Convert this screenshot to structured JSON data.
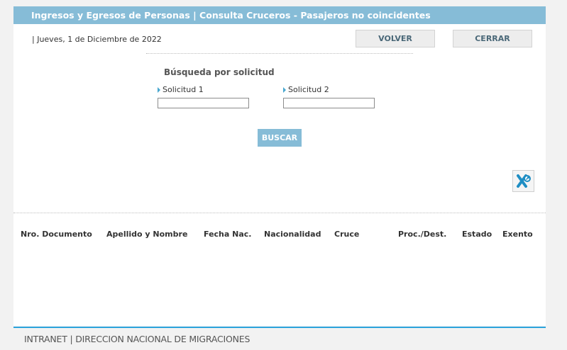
{
  "header": {
    "title": "Ingresos y Egresos de Personas | Consulta Cruceros - Pasajeros no coincidentes"
  },
  "date": "| Jueves, 1 de Diciembre de 2022",
  "buttons": {
    "volver": "VOLVER",
    "cerrar": "CERRAR",
    "buscar": "BUSCAR"
  },
  "search": {
    "title": "Búsqueda por solicitud",
    "field1_label": "Solicitud 1",
    "field1_value": "",
    "field2_label": "Solicitud 2",
    "field2_value": ""
  },
  "export_icon": "excel-export-icon",
  "table": {
    "columns": [
      "Nro. Documento",
      "Apellido y Nombre",
      "Fecha Nac.",
      "Nacionalidad",
      "Cruce",
      "Proc./Dest.",
      "Estado",
      "Exento"
    ],
    "rows": []
  },
  "footer": {
    "text": "INTRANET | DIRECCION NACIONAL DE MIGRACIONES"
  },
  "colors": {
    "header": "#86bcd7",
    "accent": "#2ca3dc",
    "excel": "#1f8ec4"
  }
}
